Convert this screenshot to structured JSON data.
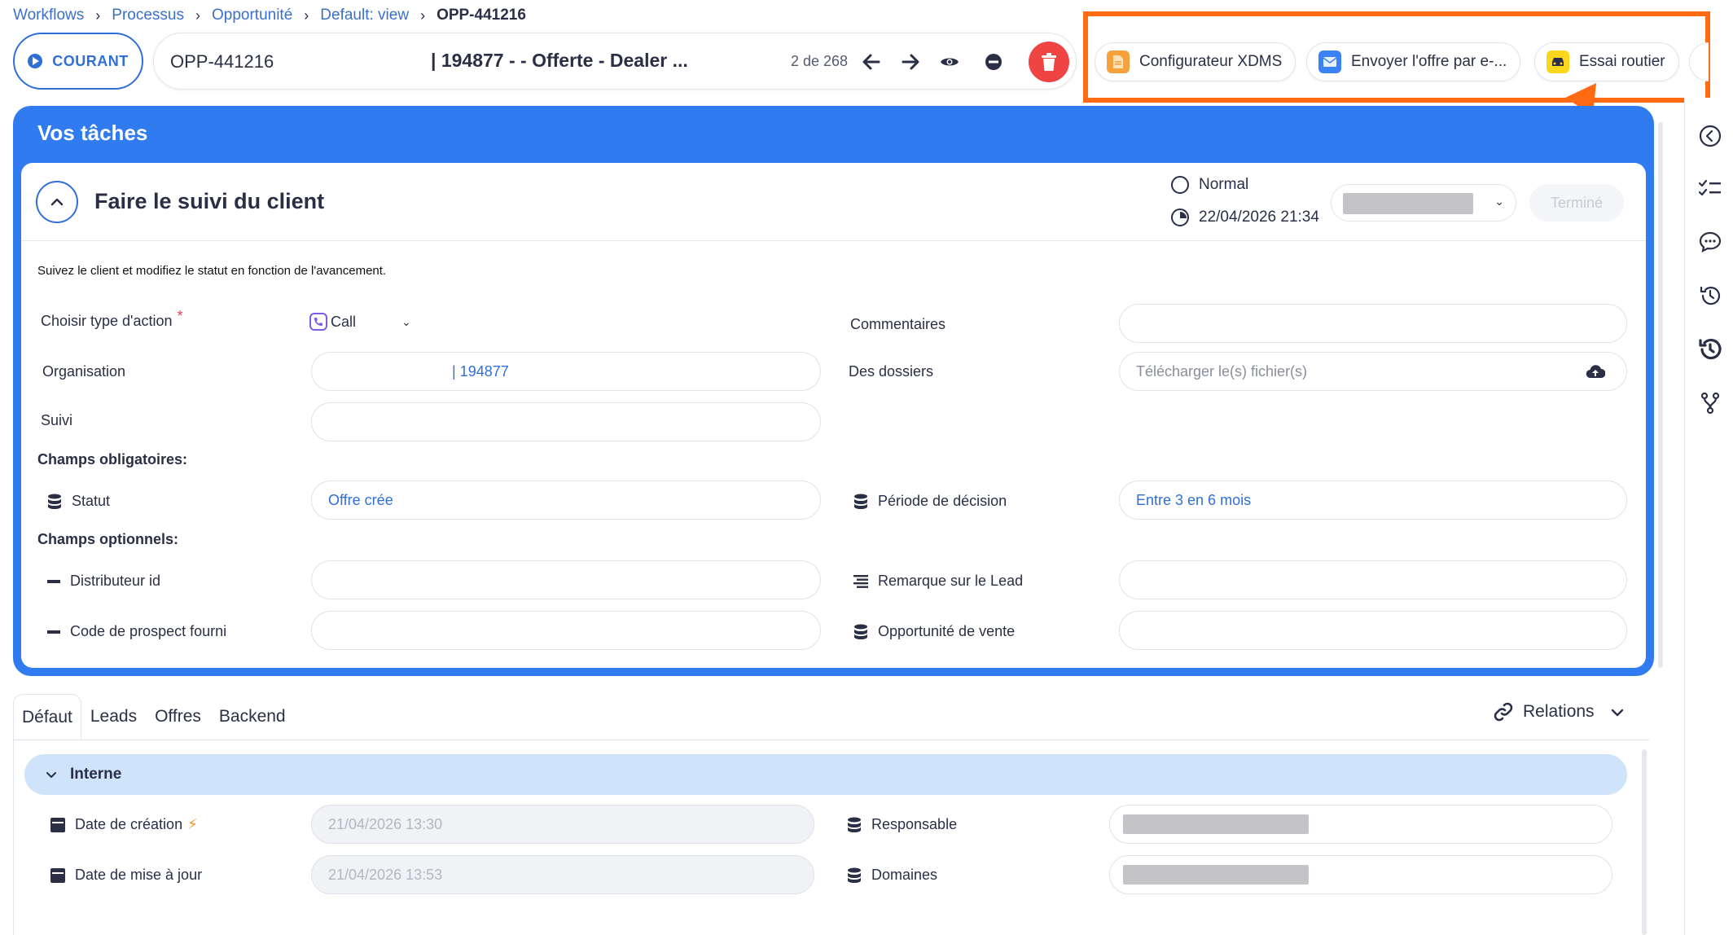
{
  "breadcrumb": [
    "Workflows",
    "Processus",
    "Opportunité",
    "Default: view",
    "OPP-441216"
  ],
  "header": {
    "status_label": "COURANT",
    "record_id": "OPP-441216",
    "record_title": "| 194877 - - Offerte - Dealer ...",
    "record_count": "2 de 268"
  },
  "actions": [
    {
      "label": "Configurateur XDMS",
      "icon": "document-icon",
      "color": "#f5a13c"
    },
    {
      "label": "Envoyer l'offre par e-...",
      "icon": "mail-icon",
      "color": "#3b82f6"
    },
    {
      "label": "Essai routier",
      "icon": "car-icon",
      "color": "#f9d71c"
    }
  ],
  "tasks": {
    "panel_title": "Vos tâches",
    "task_title": "Faire le suivi du client",
    "priority": "Normal",
    "due_date": "22/04/2026 21:34",
    "done_label": "Terminé",
    "description": "Suivez le client et modifiez le statut en fonction de l'avancement.",
    "fields": {
      "action_type_label": "Choisir type d'action",
      "action_type_required": "*",
      "action_type_value": "Call",
      "comments_label": "Commentaires",
      "organisation_label": "Organisation",
      "organisation_value": "| 194877",
      "files_label": "Des dossiers",
      "files_placeholder": "Télécharger le(s) fichier(s)",
      "followup_label": "Suivi"
    },
    "required_heading": "Champs obligatoires:",
    "status_label": "Statut",
    "status_value": "Offre crée",
    "decision_label": "Période de décision",
    "decision_value": "Entre 3 en 6 mois",
    "optional_heading": "Champs optionnels:",
    "distributor_label": "Distributeur id",
    "lead_remark_label": "Remarque sur le Lead",
    "prospect_code_label": "Code de prospect fourni",
    "sales_opp_label": "Opportunité de vente"
  },
  "tabs": [
    "Défaut",
    "Leads",
    "Offres",
    "Backend"
  ],
  "relations_label": "Relations",
  "internal": {
    "section_title": "Interne",
    "created_label": "Date de création",
    "created_value": "21/04/2026 13:30",
    "updated_label": "Date de mise à jour",
    "updated_value": "21/04/2026 13:53",
    "owner_label": "Responsable",
    "domains_label": "Domaines"
  },
  "colors": {
    "accent": "#2f7bef",
    "highlight": "#ff6a13",
    "delete": "#ef4444"
  }
}
